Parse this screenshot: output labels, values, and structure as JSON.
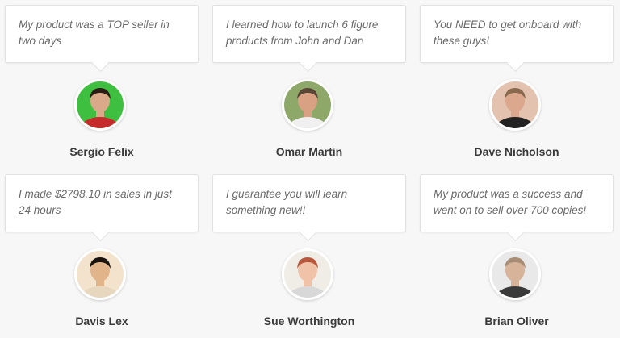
{
  "testimonials": [
    {
      "quote": "My product was a TOP seller in two days",
      "name": "Sergio Felix",
      "avatar_bg": "#3fbf3f",
      "skin": "#d9a98a",
      "hair": "#2a1d16",
      "shirt": "#c52b2b"
    },
    {
      "quote": "I learned how to launch 6 figure products from John and Dan",
      "name": "Omar Martin",
      "avatar_bg": "#8ea86a",
      "skin": "#d8a184",
      "hair": "#5a4636",
      "shirt": "#f0f0f0"
    },
    {
      "quote": "You NEED to get onboard with these guys!",
      "name": "Dave Nicholson",
      "avatar_bg": "#e4c2b0",
      "skin": "#dba88e",
      "hair": "#8a6a4e",
      "shirt": "#222222"
    },
    {
      "quote": "I made $2798.10 in sales in just 24 hours",
      "name": "Davis Lex",
      "avatar_bg": "#f3e2cc",
      "skin": "#e2b48a",
      "hair": "#1a120c",
      "shirt": "#e8d7bf"
    },
    {
      "quote": "I guarantee you will learn something new!!",
      "name": "Sue Worthington",
      "avatar_bg": "#f0ece6",
      "skin": "#f0c3a8",
      "hair": "#b8583c",
      "shirt": "#d8d8d8"
    },
    {
      "quote": "My product was a success and went on to sell over 700 copies!",
      "name": "Brian Oliver",
      "avatar_bg": "#e9e9e9",
      "skin": "#d7b39a",
      "hair": "#a88e76",
      "shirt": "#3a3a3a"
    }
  ]
}
